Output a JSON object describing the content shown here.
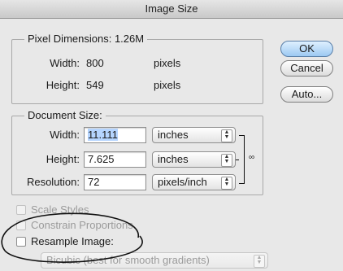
{
  "window": {
    "title": "Image Size"
  },
  "pixel_dimensions": {
    "legend": "Pixel Dimensions:",
    "size": "1.26M",
    "width_label": "Width:",
    "width_value": "800",
    "width_unit": "pixels",
    "height_label": "Height:",
    "height_value": "549",
    "height_unit": "pixels"
  },
  "document_size": {
    "legend": "Document Size:",
    "width_label": "Width:",
    "width_value": "11.111",
    "width_unit": "inches",
    "height_label": "Height:",
    "height_value": "7.625",
    "height_unit": "inches",
    "resolution_label": "Resolution:",
    "resolution_value": "72",
    "resolution_unit": "pixels/inch"
  },
  "buttons": {
    "ok": "OK",
    "cancel": "Cancel",
    "auto": "Auto..."
  },
  "options": {
    "scale_styles": "Scale Styles",
    "constrain_proportions": "Constrain Proportions",
    "resample_image": "Resample Image:",
    "resample_method": "Bicubic (best for smooth gradients)"
  },
  "icons": {
    "link": "chain-link-icon",
    "popup_arrows": "up-down-arrows-icon"
  }
}
